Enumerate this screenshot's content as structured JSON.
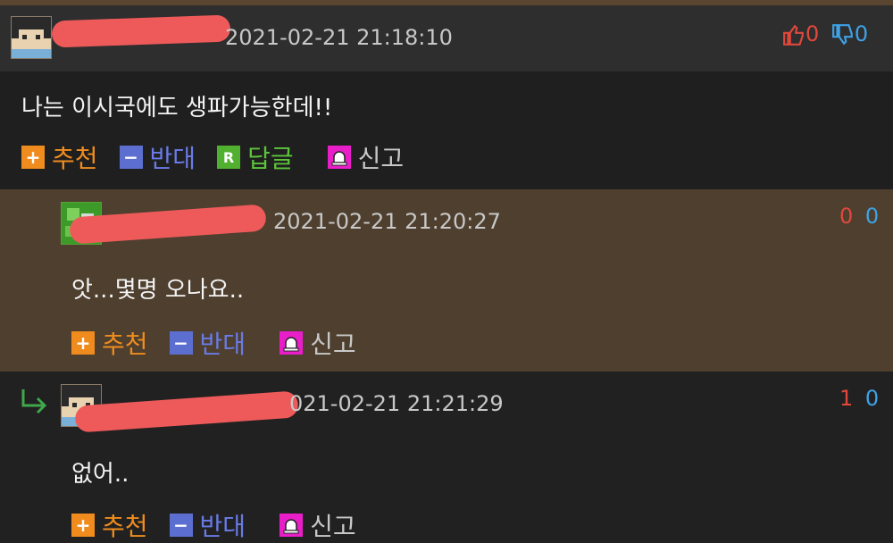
{
  "comments": [
    {
      "date": "2021-02-21 21:18:10",
      "up": "0",
      "down": "0",
      "text": "나는 이시국에도 생파가능한데!!",
      "actions": {
        "recommend": "추천",
        "oppose": "반대",
        "reply": "답글",
        "report": "신고"
      }
    },
    {
      "date": "2021-02-21 21:20:27",
      "up": "0",
      "down": "0",
      "text": "앗...몇명 오나요..",
      "actions": {
        "recommend": "추천",
        "oppose": "반대",
        "report": "신고"
      }
    },
    {
      "date": "021-02-21 21:21:29",
      "up": "1",
      "down": "0",
      "text": "없어..",
      "actions": {
        "recommend": "추천",
        "oppose": "반대",
        "report": "신고"
      }
    }
  ],
  "icons": {
    "plus": "+",
    "minus": "−",
    "reply": "R"
  },
  "colors": {
    "recommend": "#f08c1e",
    "oppose": "#5c6fd0",
    "reply": "#52b030",
    "report": "#e81ec8",
    "upvote": "#e0483c",
    "downvote": "#3ea2e6",
    "redaction": "#ee5a5a",
    "nested_reply_bg": "#4e3f2e"
  }
}
